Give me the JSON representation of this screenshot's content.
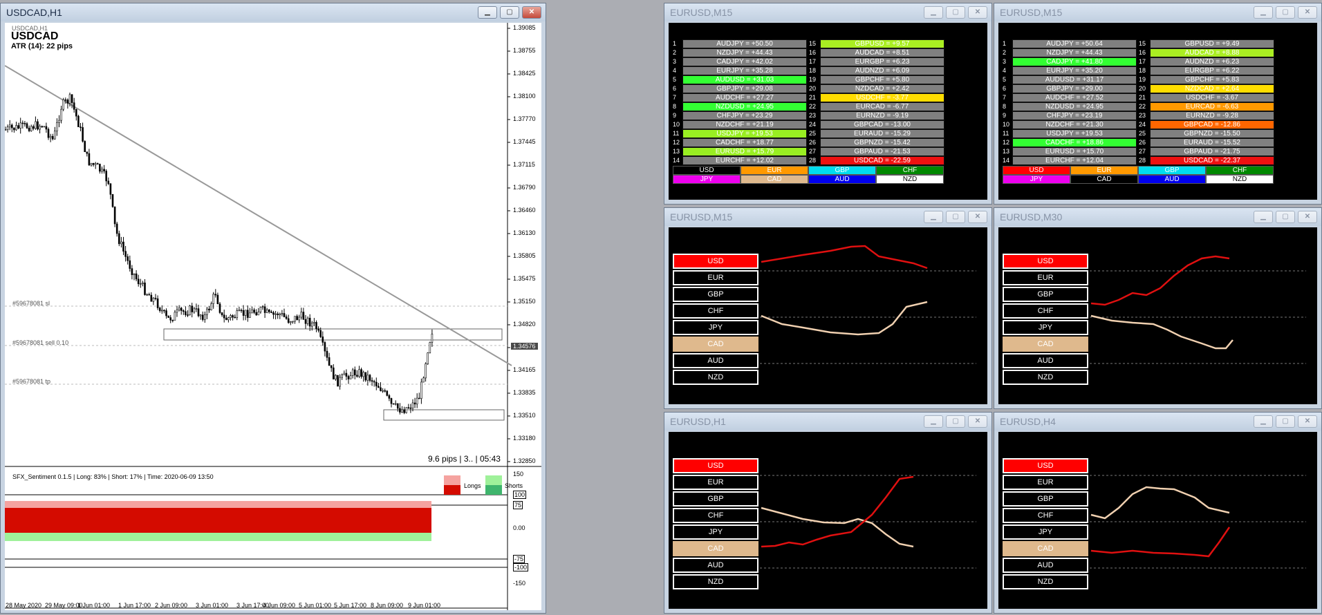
{
  "main": {
    "title": "USDCAD,H1",
    "label_small": "USDCAD,H1",
    "symbol": "USDCAD",
    "atr": "ATR (14): 22 pips",
    "order_sl": "#59678081 sl",
    "order_sell": "#59678081 sell 0.10",
    "order_tp": "#59678081 tp",
    "status": "9.6 pips | 3.. | 05:43",
    "price_labels": [
      "1.39085",
      "1.38755",
      "1.38425",
      "1.38100",
      "1.37770",
      "1.37445",
      "1.37115",
      "1.36790",
      "1.36460",
      "1.36130",
      "1.35805",
      "1.35475",
      "1.35150",
      "1.34820",
      "1.34490",
      "1.34165",
      "1.33835",
      "1.33510",
      "1.33180",
      "1.32850"
    ],
    "current_price": "1.34576",
    "time_labels": [
      "28 May 2020",
      "29 May 09:00",
      "1 Jun 01:00",
      "1 Jun 17:00",
      "2 Jun 09:00",
      "3 Jun 01:00",
      "3 Jun 17:00",
      "4 Jun 09:00",
      "5 Jun 01:00",
      "5 Jun 17:00",
      "8 Jun 09:00",
      "9 Jun 01:00"
    ],
    "sentiment": {
      "header": "SFX_Sentiment 0.1.5 | Long: 83% | Short: 17% | Time: 2020-06-09 13:50",
      "legend_longs": "Longs",
      "legend_shorts": "Shorts",
      "levels": [
        "150",
        "100",
        "75",
        "0.00",
        "-75",
        "-100",
        "-150"
      ]
    }
  },
  "strength_windows": [
    {
      "title": "EURUSD,M15",
      "left": [
        {
          "n": "1",
          "t": "AUDJPY = +50.50",
          "c": "#808080"
        },
        {
          "n": "2",
          "t": "NZDJPY = +44.43",
          "c": "#808080"
        },
        {
          "n": "3",
          "t": "CADJPY = +42.02",
          "c": "#808080"
        },
        {
          "n": "4",
          "t": "EURJPY = +35.28",
          "c": "#808080"
        },
        {
          "n": "5",
          "t": "AUDUSD = +31.03",
          "c": "#33ff33"
        },
        {
          "n": "6",
          "t": "GBPJPY = +29.08",
          "c": "#808080"
        },
        {
          "n": "7",
          "t": "AUDCHF = +27.27",
          "c": "#808080"
        },
        {
          "n": "8",
          "t": "NZDUSD = +24.95",
          "c": "#33ff33"
        },
        {
          "n": "9",
          "t": "CHFJPY = +23.29",
          "c": "#808080"
        },
        {
          "n": "10",
          "t": "NZDCHF = +21.19",
          "c": "#808080"
        },
        {
          "n": "11",
          "t": "USDJPY = +19.53",
          "c": "#99ee22"
        },
        {
          "n": "12",
          "t": "CADCHF = +18.77",
          "c": "#808080"
        },
        {
          "n": "13",
          "t": "EURUSD = +15.79",
          "c": "#99ee22"
        },
        {
          "n": "14",
          "t": "EURCHF = +12.02",
          "c": "#808080"
        }
      ],
      "right": [
        {
          "n": "15",
          "t": "GBPUSD = +9.57",
          "c": "#aaee22"
        },
        {
          "n": "16",
          "t": "AUDCAD = +8.51",
          "c": "#808080"
        },
        {
          "n": "17",
          "t": "EURGBP = +6.23",
          "c": "#808080"
        },
        {
          "n": "18",
          "t": "AUDNZD = +6.09",
          "c": "#808080"
        },
        {
          "n": "19",
          "t": "GBPCHF = +5.80",
          "c": "#808080"
        },
        {
          "n": "20",
          "t": "NZDCAD = +2.42",
          "c": "#808080"
        },
        {
          "n": "21",
          "t": "USDCHF = -3.77",
          "c": "#ffdd00"
        },
        {
          "n": "22",
          "t": "EURCAD = -6.77",
          "c": "#808080"
        },
        {
          "n": "23",
          "t": "EURNZD = -9.19",
          "c": "#808080"
        },
        {
          "n": "24",
          "t": "GBPCAD = -13.00",
          "c": "#808080"
        },
        {
          "n": "25",
          "t": "EURAUD = -15.29",
          "c": "#808080"
        },
        {
          "n": "26",
          "t": "GBPNZD = -15.42",
          "c": "#808080"
        },
        {
          "n": "27",
          "t": "GBPAUD = -21.53",
          "c": "#808080"
        },
        {
          "n": "28",
          "t": "USDCAD = -22.59",
          "c": "#ee1111"
        }
      ],
      "currencies": [
        {
          "t": "USD",
          "bg": "#000000",
          "fg": "#ffffff"
        },
        {
          "t": "EUR",
          "bg": "#ff9900",
          "fg": "#ffffff"
        },
        {
          "t": "GBP",
          "bg": "#00ddee",
          "fg": "#ffffff"
        },
        {
          "t": "CHF",
          "bg": "#008800",
          "fg": "#ffffff"
        },
        {
          "t": "JPY",
          "bg": "#ee00ee",
          "fg": "#ffffff"
        },
        {
          "t": "CAD",
          "bg": "#dfb98d",
          "fg": "#ffffff"
        },
        {
          "t": "AUD",
          "bg": "#0000ee",
          "fg": "#ffffff"
        },
        {
          "t": "NZD",
          "bg": "#ffffff",
          "fg": "#000000"
        }
      ]
    },
    {
      "title": "EURUSD,M15",
      "left": [
        {
          "n": "1",
          "t": "AUDJPY = +50.64",
          "c": "#808080"
        },
        {
          "n": "2",
          "t": "NZDJPY = +44.43",
          "c": "#808080"
        },
        {
          "n": "3",
          "t": "CADJPY = +41.80",
          "c": "#33ff33"
        },
        {
          "n": "4",
          "t": "EURJPY = +35.20",
          "c": "#808080"
        },
        {
          "n": "5",
          "t": "AUDUSD = +31.17",
          "c": "#808080"
        },
        {
          "n": "6",
          "t": "GBPJPY = +29.00",
          "c": "#808080"
        },
        {
          "n": "7",
          "t": "AUDCHF = +27.52",
          "c": "#808080"
        },
        {
          "n": "8",
          "t": "NZDUSD = +24.95",
          "c": "#808080"
        },
        {
          "n": "9",
          "t": "CHFJPY = +23.19",
          "c": "#808080"
        },
        {
          "n": "10",
          "t": "NZDCHF = +21.30",
          "c": "#808080"
        },
        {
          "n": "11",
          "t": "USDJPY = +19.53",
          "c": "#808080"
        },
        {
          "n": "12",
          "t": "CADCHF = +18.86",
          "c": "#33ff33"
        },
        {
          "n": "13",
          "t": "EURUSD = +15.70",
          "c": "#808080"
        },
        {
          "n": "14",
          "t": "EURCHF = +12.04",
          "c": "#808080"
        }
      ],
      "right": [
        {
          "n": "15",
          "t": "GBPUSD = +9.49",
          "c": "#808080"
        },
        {
          "n": "16",
          "t": "AUDCAD = +8.88",
          "c": "#aaee22"
        },
        {
          "n": "17",
          "t": "AUDNZD = +6.23",
          "c": "#808080"
        },
        {
          "n": "18",
          "t": "EURGBP = +6.22",
          "c": "#808080"
        },
        {
          "n": "19",
          "t": "GBPCHF = +5.83",
          "c": "#808080"
        },
        {
          "n": "20",
          "t": "NZDCAD = +2.64",
          "c": "#ffdd00"
        },
        {
          "n": "21",
          "t": "USDCHF = -3.67",
          "c": "#808080"
        },
        {
          "n": "22",
          "t": "EURCAD = -6.63",
          "c": "#ff9900"
        },
        {
          "n": "23",
          "t": "EURNZD = -9.28",
          "c": "#808080"
        },
        {
          "n": "24",
          "t": "GBPCAD = -12.86",
          "c": "#ff6600"
        },
        {
          "n": "25",
          "t": "GBPNZD = -15.50",
          "c": "#808080"
        },
        {
          "n": "26",
          "t": "EURAUD = -15.52",
          "c": "#808080"
        },
        {
          "n": "27",
          "t": "GBPAUD = -21.75",
          "c": "#808080"
        },
        {
          "n": "28",
          "t": "USDCAD = -22.37",
          "c": "#ee1111"
        }
      ],
      "currencies": [
        {
          "t": "USD",
          "bg": "#ff0000",
          "fg": "#ffffff"
        },
        {
          "t": "EUR",
          "bg": "#ff9900",
          "fg": "#ffffff"
        },
        {
          "t": "GBP",
          "bg": "#00ddee",
          "fg": "#ffffff"
        },
        {
          "t": "CHF",
          "bg": "#008800",
          "fg": "#ffffff"
        },
        {
          "t": "JPY",
          "bg": "#ee00ee",
          "fg": "#ffffff"
        },
        {
          "t": "CAD",
          "bg": "#000000",
          "fg": "#ffffff"
        },
        {
          "t": "AUD",
          "bg": "#0000ee",
          "fg": "#ffffff"
        },
        {
          "t": "NZD",
          "bg": "#ffffff",
          "fg": "#000000"
        }
      ]
    }
  ],
  "panels": [
    {
      "title": "EURUSD,M15",
      "buttons": [
        "USD",
        "EUR",
        "GBP",
        "CHF",
        "JPY",
        "CAD",
        "AUD",
        "NZD"
      ],
      "red": [
        [
          0,
          50
        ],
        [
          60,
          40
        ],
        [
          100,
          34
        ],
        [
          130,
          28
        ],
        [
          150,
          27
        ],
        [
          170,
          42
        ],
        [
          200,
          48
        ],
        [
          220,
          52
        ],
        [
          240,
          59
        ]
      ],
      "tan": [
        [
          0,
          128
        ],
        [
          30,
          140
        ],
        [
          60,
          145
        ],
        [
          100,
          152
        ],
        [
          140,
          155
        ],
        [
          170,
          153
        ],
        [
          190,
          140
        ],
        [
          210,
          115
        ],
        [
          240,
          108
        ]
      ]
    },
    {
      "title": "EURUSD,M30",
      "buttons": [
        "USD",
        "EUR",
        "GBP",
        "CHF",
        "JPY",
        "CAD",
        "AUD",
        "NZD"
      ],
      "red": [
        [
          0,
          110
        ],
        [
          20,
          112
        ],
        [
          40,
          105
        ],
        [
          60,
          95
        ],
        [
          80,
          98
        ],
        [
          100,
          88
        ],
        [
          120,
          70
        ],
        [
          140,
          55
        ],
        [
          160,
          45
        ],
        [
          180,
          42
        ],
        [
          200,
          45
        ]
      ],
      "tan": [
        [
          0,
          128
        ],
        [
          30,
          135
        ],
        [
          60,
          138
        ],
        [
          90,
          140
        ],
        [
          110,
          148
        ],
        [
          130,
          158
        ],
        [
          160,
          168
        ],
        [
          180,
          175
        ],
        [
          195,
          175
        ],
        [
          205,
          163
        ]
      ]
    },
    {
      "title": "EURUSD,H1",
      "buttons": [
        "USD",
        "EUR",
        "GBP",
        "CHF",
        "JPY",
        "CAD",
        "AUD",
        "NZD"
      ],
      "red": [
        [
          0,
          166
        ],
        [
          20,
          165
        ],
        [
          40,
          160
        ],
        [
          60,
          163
        ],
        [
          80,
          156
        ],
        [
          100,
          150
        ],
        [
          130,
          145
        ],
        [
          160,
          120
        ],
        [
          180,
          95
        ],
        [
          200,
          68
        ],
        [
          220,
          65
        ]
      ],
      "tan": [
        [
          0,
          110
        ],
        [
          30,
          118
        ],
        [
          60,
          126
        ],
        [
          90,
          131
        ],
        [
          120,
          132
        ],
        [
          140,
          126
        ],
        [
          160,
          132
        ],
        [
          180,
          148
        ],
        [
          200,
          162
        ],
        [
          220,
          166
        ]
      ]
    },
    {
      "title": "EURUSD,H4",
      "buttons": [
        "USD",
        "EUR",
        "GBP",
        "CHF",
        "JPY",
        "CAD",
        "AUD",
        "NZD"
      ],
      "red": [
        [
          0,
          172
        ],
        [
          30,
          175
        ],
        [
          60,
          172
        ],
        [
          90,
          175
        ],
        [
          120,
          176
        ],
        [
          150,
          178
        ],
        [
          170,
          180
        ],
        [
          185,
          160
        ],
        [
          200,
          138
        ]
      ],
      "tan": [
        [
          0,
          120
        ],
        [
          20,
          125
        ],
        [
          40,
          110
        ],
        [
          60,
          90
        ],
        [
          80,
          80
        ],
        [
          100,
          82
        ],
        [
          120,
          83
        ],
        [
          150,
          95
        ],
        [
          170,
          110
        ],
        [
          200,
          117
        ]
      ]
    }
  ]
}
